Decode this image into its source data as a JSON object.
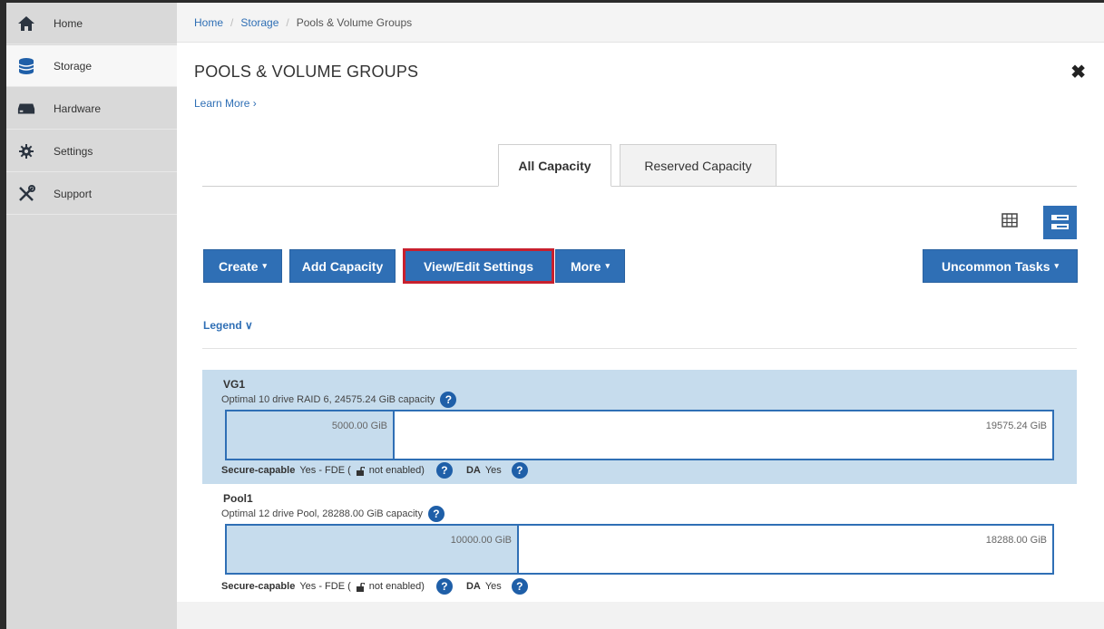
{
  "sidebar": {
    "items": [
      {
        "label": "Home",
        "icon": "home-icon"
      },
      {
        "label": "Storage",
        "icon": "storage-icon"
      },
      {
        "label": "Hardware",
        "icon": "hardware-icon"
      },
      {
        "label": "Settings",
        "icon": "gear-icon"
      },
      {
        "label": "Support",
        "icon": "tools-icon"
      }
    ]
  },
  "breadcrumb": {
    "home": "Home",
    "storage": "Storage",
    "current": "Pools & Volume Groups",
    "separator": "/"
  },
  "page": {
    "title": "POOLS & VOLUME GROUPS",
    "learn_more": "Learn More ›",
    "close": "✖"
  },
  "tabs": [
    {
      "label": "All Capacity",
      "active": true
    },
    {
      "label": "Reserved Capacity",
      "active": false
    }
  ],
  "toolbar": {
    "create": "Create",
    "add_capacity": "Add Capacity",
    "view_edit_settings": "View/Edit Settings",
    "more": "More",
    "uncommon_tasks": "Uncommon Tasks",
    "caret": "▾"
  },
  "legend": {
    "label": "Legend ∨"
  },
  "groups": [
    {
      "name": "VG1",
      "description": "Optimal 10 drive RAID 6, 24575.24 GiB capacity",
      "used": "5000.00 GiB",
      "used_fraction": 0.2035,
      "free": "19575.24 GiB",
      "secure_label": "Secure-capable",
      "secure_value": "Yes - FDE (",
      "secure_suffix": "not enabled)",
      "da_label": "DA",
      "da_value": "Yes",
      "selected": true
    },
    {
      "name": "Pool1",
      "description": "Optimal 12 drive Pool, 28288.00 GiB capacity",
      "used": "10000.00 GiB",
      "used_fraction": 0.3535,
      "free": "18288.00 GiB",
      "secure_label": "Secure-capable",
      "secure_value": "Yes - FDE (",
      "secure_suffix": "not enabled)",
      "da_label": "DA",
      "da_value": "Yes",
      "selected": false
    }
  ],
  "help_glyph": "?",
  "colors": {
    "accent": "#2f6fb5",
    "selected_row": "#c6dced",
    "highlight_border": "#c8202e",
    "sidebar_bg": "#d9d9d9"
  }
}
